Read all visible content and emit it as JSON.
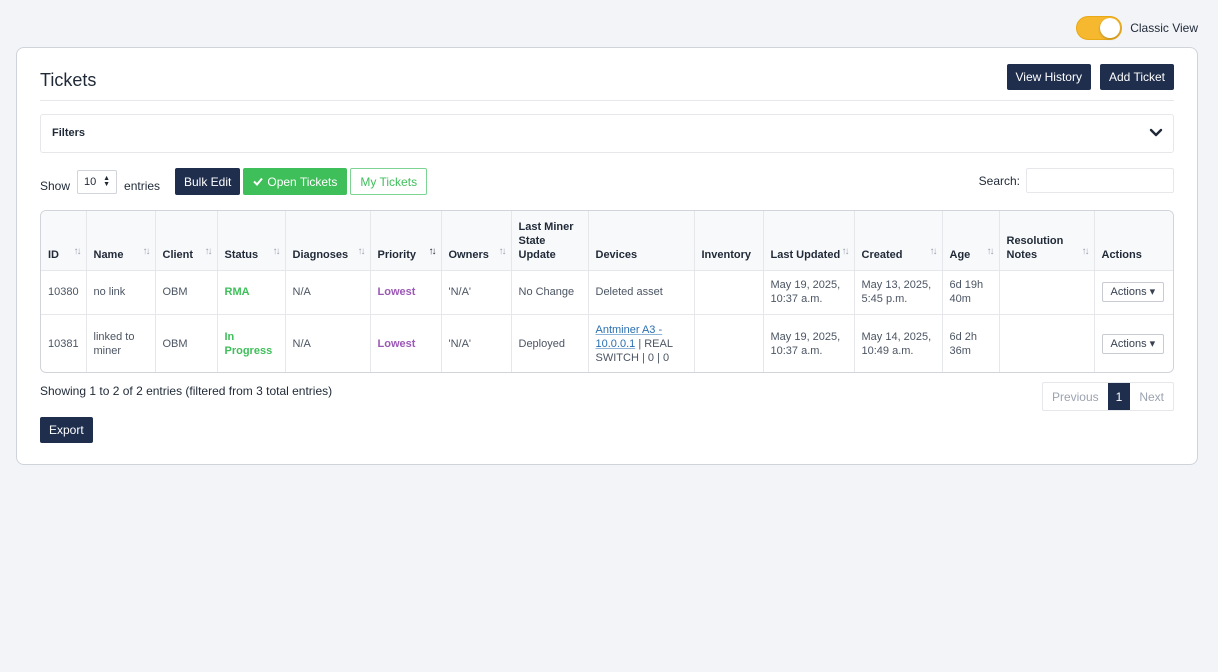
{
  "view_toggle": {
    "label": "Classic View",
    "on": true,
    "color": "#f5b82e"
  },
  "header": {
    "title": "Tickets",
    "view_history": "View History",
    "add_ticket": "Add Ticket"
  },
  "filters": {
    "label": "Filters",
    "icon": "chevron-down-icon"
  },
  "controls": {
    "show_label": "Show",
    "entries_value": "10",
    "entries_label": "entries",
    "bulk_edit": "Bulk Edit",
    "open_tickets": "Open Tickets",
    "my_tickets": "My Tickets",
    "search_label": "Search:",
    "search_value": ""
  },
  "table": {
    "columns": [
      "ID",
      "Name",
      "Client",
      "Status",
      "Diagnoses",
      "Priority",
      "Owners",
      "Last Miner State Update",
      "Devices",
      "Inventory",
      "Last Updated",
      "Created",
      "Age",
      "Resolution Notes",
      "Actions"
    ],
    "rows": [
      {
        "id": "10380",
        "name": "no link",
        "client": "OBM",
        "status": "RMA",
        "diagnoses": "N/A",
        "priority": "Lowest",
        "owners": "'N/A'",
        "last_miner_state": "No Change",
        "devices_text": "Deleted asset",
        "devices_link": "",
        "inventory": "",
        "last_updated": "May 19, 2025, 10:37 a.m.",
        "created": "May 13, 2025, 5:45 p.m.",
        "age": "6d 19h 40m",
        "resolution_notes": "",
        "actions": "Actions"
      },
      {
        "id": "10381",
        "name": "linked to miner",
        "client": "OBM",
        "status": "In Progress",
        "diagnoses": "N/A",
        "priority": "Lowest",
        "owners": "'N/A'",
        "last_miner_state": "Deployed",
        "devices_link": "Antminer A3 - 10.0.0.1",
        "devices_text": " | REAL SWITCH | 0 | 0",
        "inventory": "",
        "last_updated": "May 19, 2025, 10:37 a.m.",
        "created": "May 14, 2025, 10:49 a.m.",
        "age": "6d 2h 36m",
        "resolution_notes": "",
        "actions": "Actions"
      }
    ]
  },
  "footer": {
    "showing": "Showing 1 to 2 of 2 entries (filtered from 3 total entries)",
    "previous": "Previous",
    "page": "1",
    "next": "Next",
    "export": "Export"
  },
  "colors": {
    "primary": "#1f2e4d",
    "green": "#3fbf5a",
    "priority": "#9b59b6",
    "link": "#2a6fb0"
  }
}
